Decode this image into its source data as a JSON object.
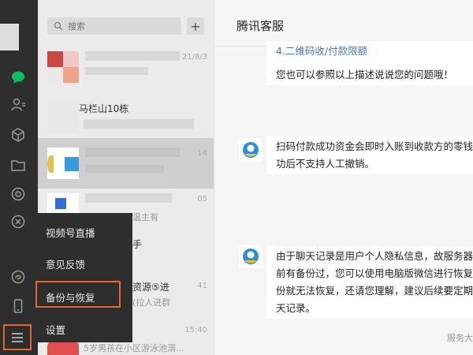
{
  "search": {
    "placeholder": "搜索",
    "add_label": "+"
  },
  "conversations": [
    {
      "time": "21/8/3",
      "name": "",
      "message": ""
    },
    {
      "time": "",
      "name": "马栏山10栋",
      "message": ""
    },
    {
      "time": "14",
      "name": "",
      "message": ""
    },
    {
      "time": "05",
      "name": "",
      "message": "温主有"
    },
    {
      "time": "",
      "name": "",
      "message": "手"
    },
    {
      "time": "41",
      "name": "资源⑤进",
      "message": "(拉人进群"
    },
    {
      "time": "15:40",
      "name": "",
      "message": "5岁男孩在小区游泳池溺..."
    }
  ],
  "popup_menu": {
    "items": [
      "视频号直播",
      "意见反馈",
      "备份与恢复",
      "设置"
    ]
  },
  "chat": {
    "title": "腾讯客服",
    "messages": [
      {
        "lines": [
          "4.二维码收/付款限额",
          "您也可以参照以上描述说说您的问题哦！"
        ]
      },
      {
        "lines": [
          "扫码付款成功资金会即时入账到收款方的零钱",
          "功后不支持人工撤销。"
        ]
      },
      {
        "lines": [
          "由于聊天记录是用户个人隐私信息，故服务器",
          "前有备份过，您可以使用电脑版微信进行恢复",
          "份就无法恢复，还请您理解，建议后续要定期",
          "天记录。"
        ]
      }
    ],
    "footer": "服务大"
  },
  "colors": {
    "highlight": "#e8652c",
    "nav_bg": "#2e2e2e",
    "active_green": "#07c160",
    "link": "#4a77c0"
  }
}
